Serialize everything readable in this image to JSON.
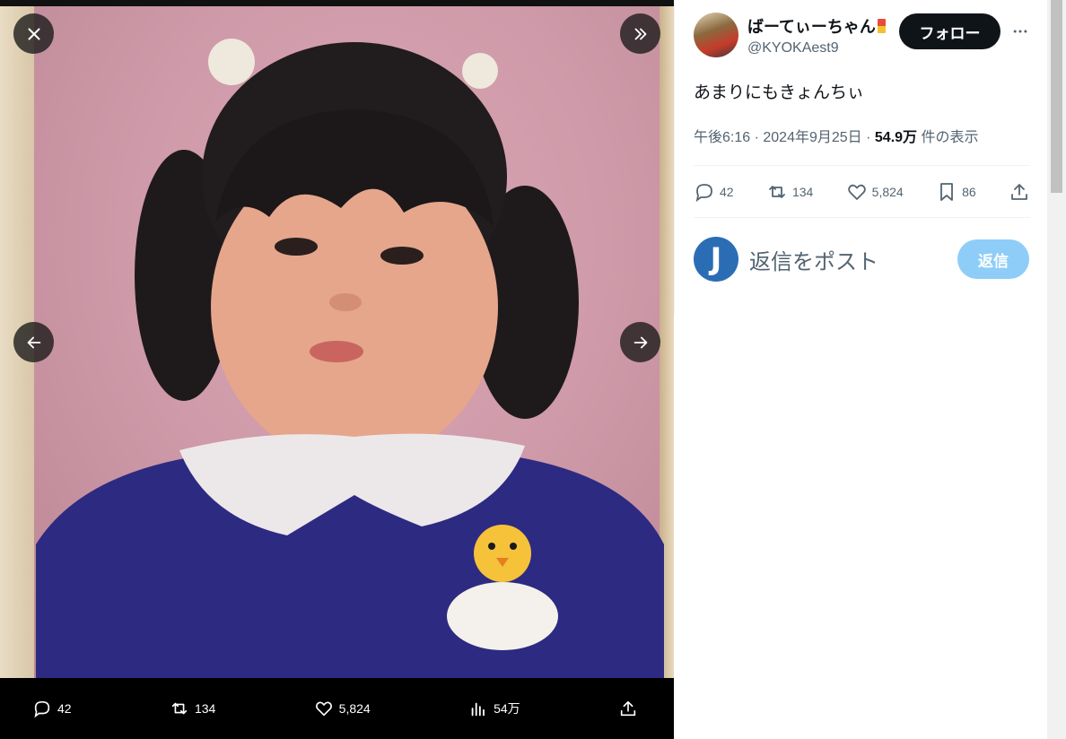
{
  "viewer": {
    "close_label": "close",
    "expand_label": "expand",
    "prev_label": "previous",
    "next_label": "next",
    "bottom_stats": {
      "replies": "42",
      "reposts": "134",
      "likes": "5,824",
      "views": "54万"
    }
  },
  "tweet": {
    "display_name": "ばーてぃーちゃん",
    "handle": "@KYOKAest9",
    "follow_label": "フォロー",
    "text": "あまりにもきょんちぃ",
    "time": "午後6:16",
    "date": "2024年9月25日",
    "views_count": "54.9万",
    "views_suffix": "件の表示",
    "stats": {
      "replies": "42",
      "reposts": "134",
      "likes": "5,824",
      "bookmarks": "86"
    }
  },
  "reply_box": {
    "avatar_letter": "J",
    "placeholder": "返信をポスト",
    "button_label": "返信"
  },
  "colors": {
    "brand_dark": "#0f1419",
    "muted": "#536471",
    "reply_disabled": "#8ecdf8",
    "avatar_blue": "#2b6db5"
  }
}
